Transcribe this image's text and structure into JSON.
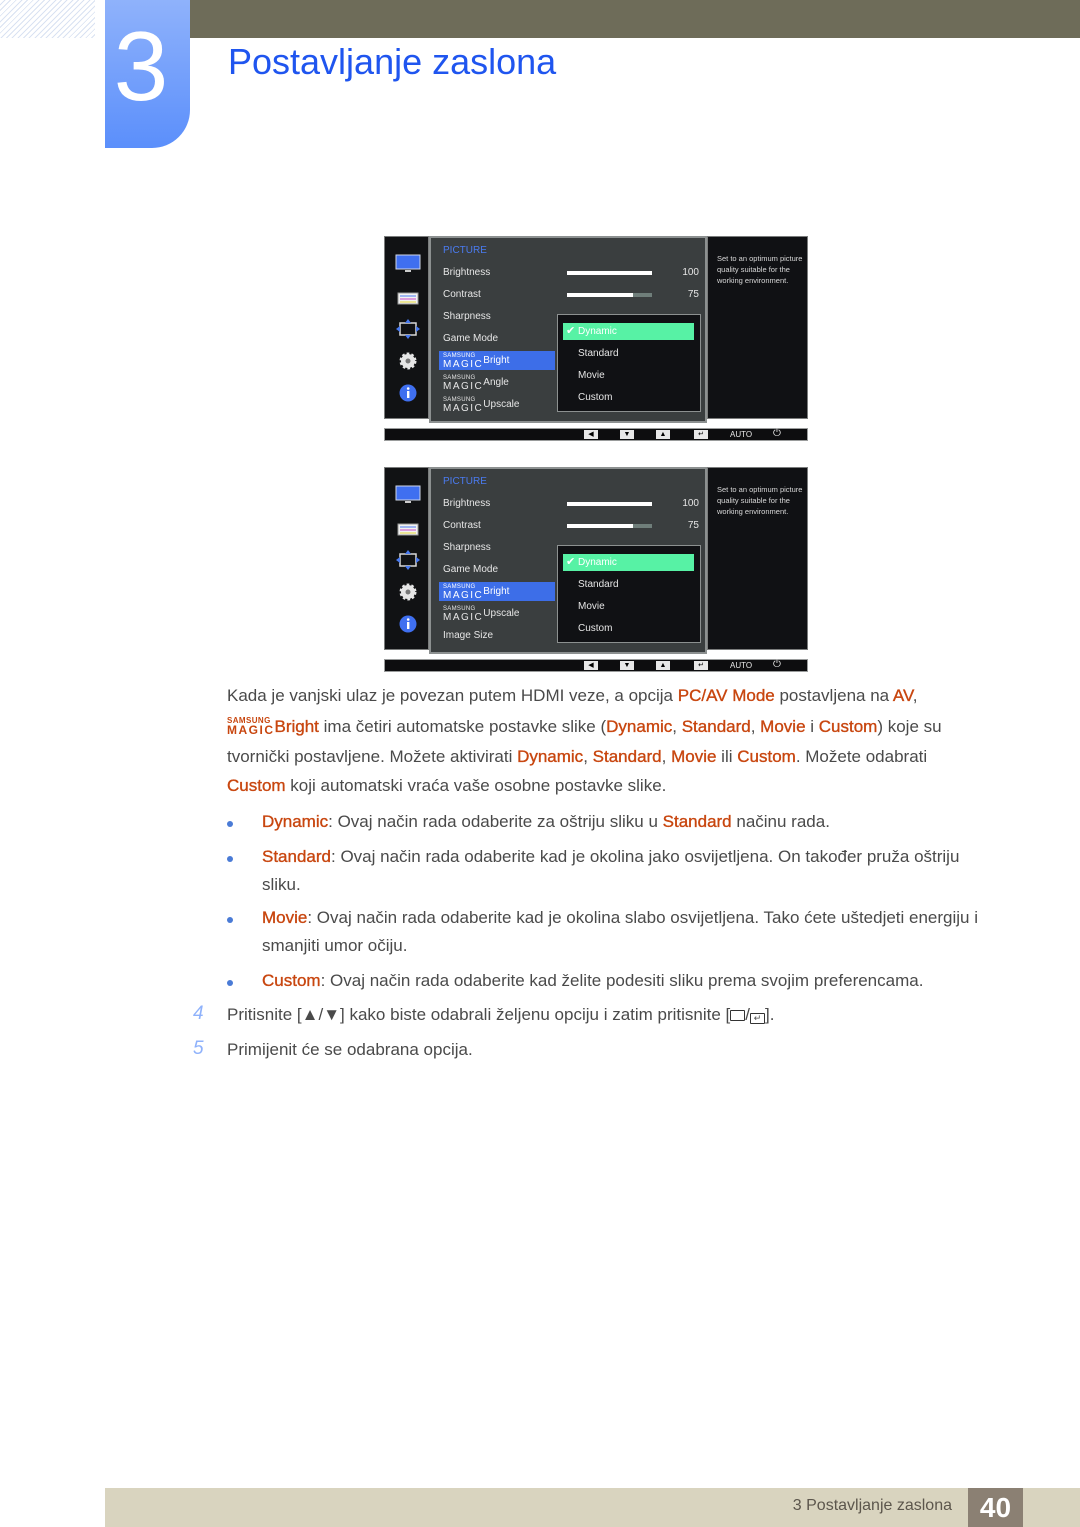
{
  "chapter": {
    "number": "3",
    "title": "Postavljanje zaslona"
  },
  "osd_screens": [
    {
      "section_title": "PICTURE",
      "side_icons": [
        "monitor-icon",
        "picture-settings-icon",
        "resize-arrows-icon",
        "gear-icon",
        "info-icon"
      ],
      "menu_items": [
        {
          "label": "Brightness"
        },
        {
          "label": "Contrast"
        },
        {
          "label": "Sharpness"
        },
        {
          "label": "Game Mode"
        },
        {
          "magic_top": "SAMSUNG",
          "magic_bottom": "MAGIC",
          "label": "Bright",
          "selected": true
        },
        {
          "magic_top": "SAMSUNG",
          "magic_bottom": "MAGIC",
          "label": "Angle"
        },
        {
          "magic_top": "SAMSUNG",
          "magic_bottom": "MAGIC",
          "label": "Upscale"
        }
      ],
      "sliders": [
        {
          "name": "Brightness",
          "value": "100",
          "fraction": 1.0
        },
        {
          "name": "Contrast",
          "value": "75",
          "fraction": 0.78
        }
      ],
      "dropdown_options": [
        {
          "label": "Dynamic",
          "selected": true
        },
        {
          "label": "Standard"
        },
        {
          "label": "Movie"
        },
        {
          "label": "Custom"
        }
      ],
      "description": "Set to an optimum picture quality suitable for the working environment.",
      "bottom_bar": {
        "buttons": [
          "left-arrow-icon",
          "down-arrow-icon",
          "up-arrow-icon",
          "enter-icon"
        ],
        "auto_label": "AUTO",
        "power": "power-icon"
      }
    },
    {
      "section_title": "PICTURE",
      "side_icons": [
        "monitor-icon",
        "picture-settings-icon",
        "resize-arrows-icon",
        "gear-icon",
        "info-icon"
      ],
      "menu_items": [
        {
          "label": "Brightness"
        },
        {
          "label": "Contrast"
        },
        {
          "label": "Sharpness"
        },
        {
          "label": "Game Mode"
        },
        {
          "magic_top": "SAMSUNG",
          "magic_bottom": "MAGIC",
          "label": "Bright",
          "selected": true
        },
        {
          "magic_top": "SAMSUNG",
          "magic_bottom": "MAGIC",
          "label": "Upscale"
        },
        {
          "label": "Image Size"
        }
      ],
      "sliders": [
        {
          "name": "Brightness",
          "value": "100",
          "fraction": 1.0
        },
        {
          "name": "Contrast",
          "value": "75",
          "fraction": 0.78
        }
      ],
      "dropdown_options": [
        {
          "label": "Dynamic",
          "selected": true
        },
        {
          "label": "Standard"
        },
        {
          "label": "Movie"
        },
        {
          "label": "Custom"
        }
      ],
      "description": "Set to an optimum picture quality suitable for the working environment.",
      "bottom_bar": {
        "buttons": [
          "left-arrow-icon",
          "down-arrow-icon",
          "up-arrow-icon",
          "enter-icon"
        ],
        "auto_label": "AUTO",
        "power": "power-icon"
      }
    }
  ],
  "intro": {
    "line1": {
      "t1": "Kada je vanjski ulaz je povezan putem HDMI veze, a opcija ",
      "h1": "PC/AV Mode",
      "t2": " postavljena na ",
      "h2": "AV",
      "t3": ","
    },
    "line2": {
      "magic_top": "SAMSUNG",
      "magic_bottom": "MAGIC",
      "h0": "Bright",
      "t1": " ima četiri automatske postavke slike (",
      "h1": "Dynamic",
      "t2": ", ",
      "h2": "Standard",
      "t3": ", ",
      "h3": "Movie",
      "t4": " i ",
      "h4": "Custom",
      "t5": ") koje su"
    },
    "line3": {
      "t1": "tvornički postavljene. Možete aktivirati ",
      "h1": "Dynamic",
      "t2": ", ",
      "h2": "Standard",
      "t3": ", ",
      "h3": "Movie",
      "t4": " ili ",
      "h4": "Custom",
      "t5": ". Možete odabrati"
    },
    "line4": {
      "h1": "Custom",
      "t1": " koji automatski vraća vaše osobne postavke slike."
    }
  },
  "bullets": [
    {
      "term": "Dynamic",
      "text": ": Ovaj način rada odaberite za oštriju sliku u ",
      "term2": "Standard",
      "text2": " načinu rada."
    },
    {
      "term": "Standard",
      "text": ": Ovaj način rada odaberite kad je okolina jako osvijetljena. On također pruža oštriju",
      "cont": "sliku."
    },
    {
      "term": "Movie",
      "text": ": Ovaj način rada odaberite kad je okolina slabo osvijetljena. Tako ćete uštedjeti energiju i",
      "cont": "smanjiti umor očiju."
    },
    {
      "term": "Custom",
      "text": ": Ovaj način rada odaberite kad želite podesiti sliku prema svojim preferencama."
    }
  ],
  "steps": [
    {
      "number": "4",
      "pre": "Pritisnite [",
      "mid": "] kako biste odabrali željenu opciju i zatim pritisnite [",
      "post": "]."
    },
    {
      "number": "5",
      "text": "Primijenit će se odabrana opcija."
    }
  ],
  "footer": {
    "chapter_label": "3 Postavljanje zaslona",
    "page_number": "40"
  },
  "colors": {
    "title_blue": "#1f55ef",
    "highlight_orange": "#c8460f",
    "osd_selected_blue": "#3d6ee8",
    "osd_dropdown_green": "#57f2a5",
    "footer_bg": "#d9d4bf",
    "footer_page_bg": "#8b8073"
  }
}
